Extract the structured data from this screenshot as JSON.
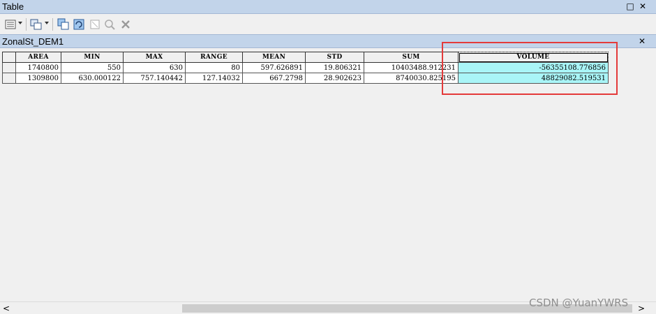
{
  "window": {
    "title": "Table"
  },
  "tab": {
    "label": "ZonalSt_DEM1"
  },
  "toolbar": {
    "buttons": [
      {
        "name": "table-options-icon"
      },
      {
        "name": "related-tables-icon"
      },
      {
        "name": "select-by-attributes-icon"
      },
      {
        "name": "switch-selection-icon"
      },
      {
        "name": "clear-selection-icon"
      },
      {
        "name": "zoom-to-selected-icon"
      },
      {
        "name": "delete-selected-icon"
      }
    ]
  },
  "table": {
    "columns": [
      "AREA",
      "MIN",
      "MAX",
      "RANGE",
      "MEAN",
      "STD",
      "SUM",
      "VOLUME"
    ],
    "rows": [
      [
        "1740800",
        "550",
        "630",
        "80",
        "597.626891",
        "19.806321",
        "10403488.912231",
        "-56355108.776856"
      ],
      [
        "1309800",
        "630.000122",
        "757.140442",
        "127.14032",
        "667.2798",
        "28.902623",
        "8740030.825195",
        "48829082.519531"
      ]
    ]
  },
  "watermark": "CSDN @YuanYWRS",
  "colors": {
    "highlight": "#a9f5f7",
    "annotation": "#e43a3a",
    "titlebar": "#c2d4ea"
  }
}
